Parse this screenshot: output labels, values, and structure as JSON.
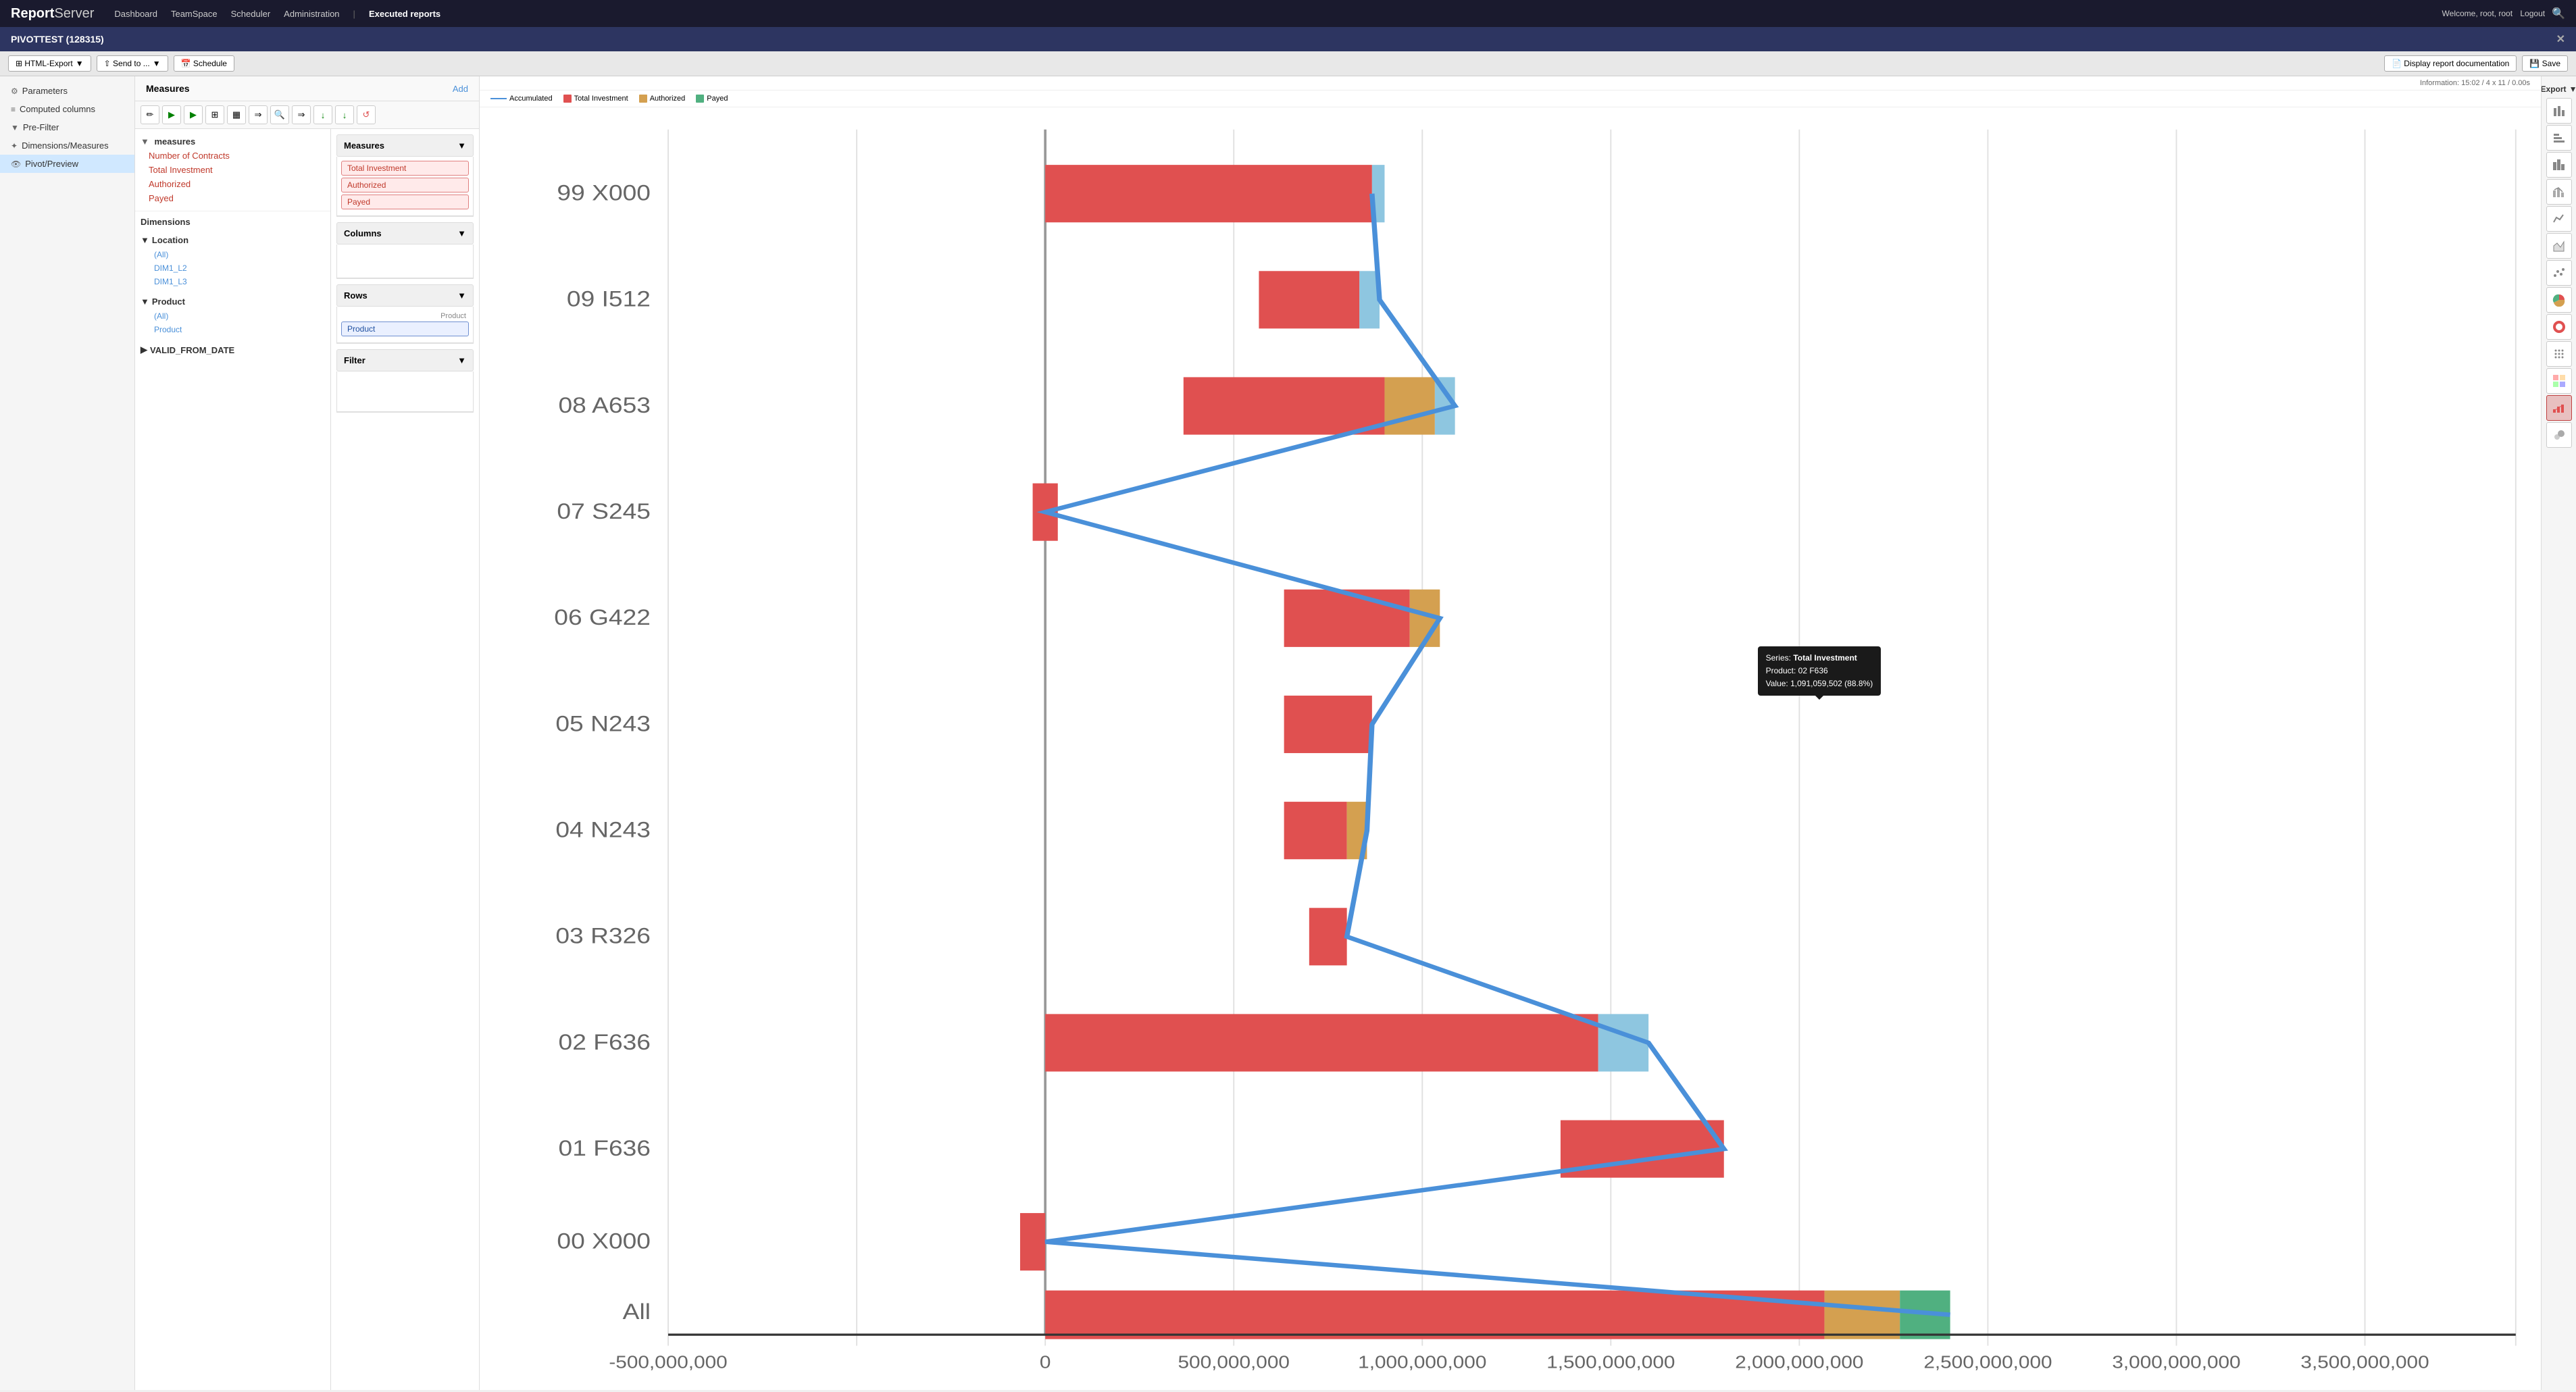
{
  "app": {
    "logo_bold": "Report",
    "logo_light": "Server",
    "nav_items": [
      "Dashboard",
      "TeamSpace",
      "Scheduler",
      "Administration"
    ],
    "nav_divider": "|",
    "nav_active": "Executed reports",
    "user_info": "Welcome, root, root",
    "logout": "Logout",
    "search_icon": "🔍"
  },
  "window": {
    "title": "PIVOTTEST (128315)",
    "close_icon": "✕"
  },
  "toolbar": {
    "html_export_label": "⊞ HTML-Export",
    "html_export_arrow": "▼",
    "send_to_label": "⇧ Send to ...",
    "send_to_arrow": "▼",
    "schedule_label": "📅 Schedule",
    "display_doc_label": "📄 Display report documentation",
    "save_label": "💾 Save"
  },
  "sidebar": {
    "items": [
      {
        "id": "parameters",
        "icon": "⚙",
        "label": "Parameters"
      },
      {
        "id": "computed-columns",
        "icon": "≡",
        "label": "Computed columns"
      },
      {
        "id": "pre-filter",
        "icon": "▼",
        "label": "Pre-Filter"
      },
      {
        "id": "dimensions-measures",
        "icon": "✦",
        "label": "Dimensions/Measures"
      },
      {
        "id": "pivot-preview",
        "icon": "👁",
        "label": "Pivot/Preview",
        "active": true
      }
    ]
  },
  "measures_panel": {
    "title": "Measures",
    "add_label": "Add",
    "tree": {
      "root": "measures",
      "items": [
        {
          "id": "number-of-contracts",
          "label": "Number of Contracts",
          "color": "red"
        },
        {
          "id": "total-investment",
          "label": "Total Investment",
          "color": "red"
        },
        {
          "id": "authorized",
          "label": "Authorized",
          "color": "red"
        },
        {
          "id": "payed",
          "label": "Payed",
          "color": "red"
        }
      ]
    },
    "dimensions_title": "Dimensions",
    "dimension_groups": [
      {
        "id": "location",
        "label": "Location",
        "items": [
          "(All)",
          "DIM1_L2",
          "DIM1_L3"
        ]
      },
      {
        "id": "product",
        "label": "Product",
        "items": [
          "(All)",
          "Product"
        ]
      },
      {
        "id": "valid-from-date",
        "label": "VALID_FROM_DATE",
        "items": []
      }
    ]
  },
  "config_panel": {
    "sections": [
      {
        "id": "measures-section",
        "label": "Measures",
        "items": [
          {
            "label": "Total Investment",
            "type": "red"
          },
          {
            "label": "Authorized",
            "type": "red"
          },
          {
            "label": "Payed",
            "type": "red"
          }
        ]
      },
      {
        "id": "columns-section",
        "label": "Columns",
        "items": []
      },
      {
        "id": "rows-section",
        "label": "Rows",
        "row_label": "Product",
        "items": [
          {
            "label": "Product",
            "type": "blue"
          }
        ]
      },
      {
        "id": "filter-section",
        "label": "Filter",
        "items": []
      }
    ]
  },
  "chart": {
    "info": "Information:  15:02  /  4 x 11  /  0.00s",
    "legend": [
      {
        "id": "accumulated",
        "label": "Accumulated",
        "color": "#4a90d9",
        "type": "line"
      },
      {
        "id": "total-investment",
        "label": "Total Investment",
        "color": "#e05050",
        "type": "box"
      },
      {
        "id": "authorized",
        "label": "Authorized",
        "color": "#d4a050",
        "type": "box"
      },
      {
        "id": "payed",
        "label": "Payed",
        "color": "#50b080",
        "type": "box"
      }
    ],
    "y_labels": [
      "99 X000",
      "09 I512",
      "08 A653",
      "07 S245",
      "06 G422",
      "05 N243",
      "04 N243",
      "03 R326",
      "02 F636",
      "01 F636",
      "00 X000",
      "All"
    ],
    "x_labels": [
      "-500,000,000",
      "0",
      "500,000,000",
      "1,000,000,000",
      "1,500,000,000",
      "2,000,000,000",
      "2,500,000,000",
      "3,000,000,000",
      "3,500,000,000"
    ],
    "tooltip": {
      "series_label": "Series:",
      "series_value": "Total Investment",
      "product_label": "Product:",
      "product_value": "02 F636",
      "value_label": "Value:",
      "value_value": "1,091,059,502 (88.8%)"
    }
  },
  "chart_tools": [
    {
      "id": "edit-tool",
      "icon": "✏",
      "title": "Edit"
    },
    {
      "id": "play-tool",
      "icon": "▶",
      "title": "Play",
      "color": "green"
    },
    {
      "id": "refresh-tool",
      "icon": "▶",
      "title": "Refresh",
      "color": "green"
    },
    {
      "id": "table-tool",
      "icon": "⊞",
      "title": "Table view"
    },
    {
      "id": "pivot-tool",
      "icon": "▦",
      "title": "Pivot view"
    },
    {
      "id": "export-tool",
      "icon": "⇒",
      "title": "Export"
    },
    {
      "id": "zoom-tool",
      "icon": "🔍",
      "title": "Zoom"
    },
    {
      "id": "forward-tool",
      "icon": "⇒",
      "title": "Forward"
    },
    {
      "id": "down-arrow-tool",
      "icon": "↓",
      "title": "Down"
    },
    {
      "id": "down2-arrow-tool",
      "icon": "↓",
      "title": "Down2"
    },
    {
      "id": "refresh2-tool",
      "icon": "↺",
      "title": "Refresh2"
    }
  ],
  "right_icons": [
    {
      "id": "export-header",
      "label": "Export",
      "is_header": true
    },
    {
      "id": "bar-chart-icon",
      "icon": "▬▬",
      "title": "Bar chart"
    },
    {
      "id": "bar-chart2-icon",
      "icon": "▮▮",
      "title": "Bar chart 2"
    },
    {
      "id": "bar-chart3-icon",
      "icon": "▌▌▌",
      "title": "Bar chart 3"
    },
    {
      "id": "mixed-chart-icon",
      "icon": "≋",
      "title": "Mixed chart"
    },
    {
      "id": "line-chart-icon",
      "icon": "∿",
      "title": "Line chart"
    },
    {
      "id": "area-chart-icon",
      "icon": "⛰",
      "title": "Area chart"
    },
    {
      "id": "scatter-icon",
      "icon": "⁚⁚",
      "title": "Scatter"
    },
    {
      "id": "pie-icon",
      "icon": "◕",
      "title": "Pie chart"
    },
    {
      "id": "donut-icon",
      "icon": "◎",
      "title": "Donut chart"
    },
    {
      "id": "grid-scatter-icon",
      "icon": "⁛⁛",
      "title": "Grid scatter"
    },
    {
      "id": "heatmap-icon",
      "icon": "▦",
      "title": "Heatmap"
    },
    {
      "id": "waterfall-icon",
      "icon": "⩏",
      "title": "Waterfall",
      "active": true
    },
    {
      "id": "bubble-icon",
      "icon": "●",
      "title": "Bubble"
    }
  ]
}
